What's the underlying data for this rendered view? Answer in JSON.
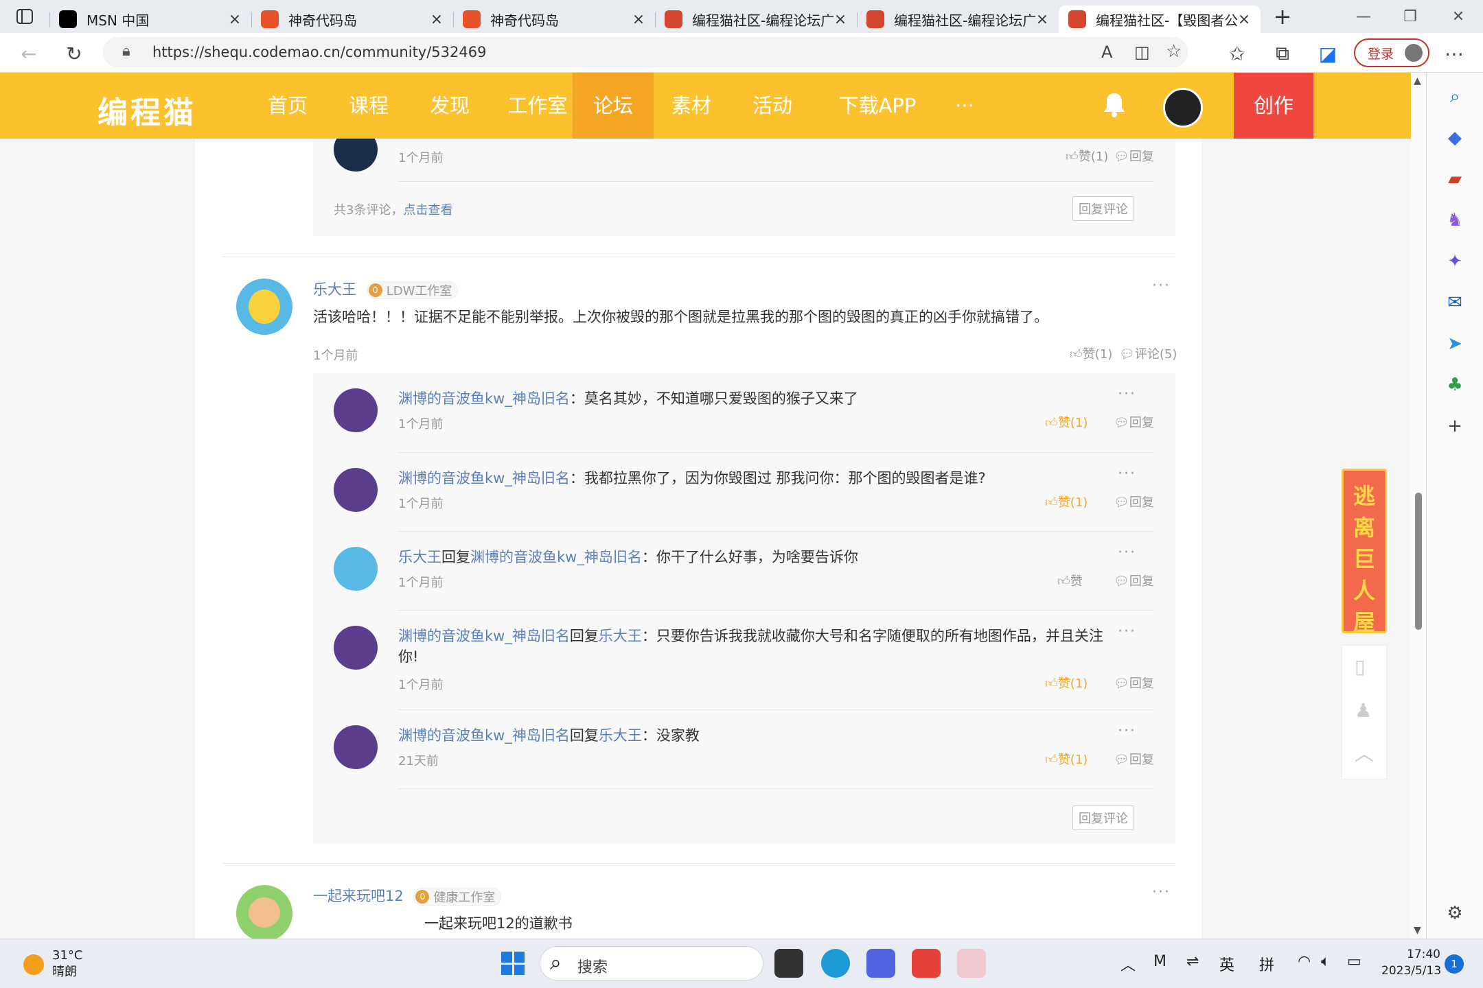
{
  "browser": {
    "tabs": [
      {
        "title": "MSN 中国",
        "favicon": "#000000",
        "active": false
      },
      {
        "title": "神奇代码岛",
        "favicon": "#e8522b",
        "active": false
      },
      {
        "title": "神奇代码岛",
        "favicon": "#e8522b",
        "active": false
      },
      {
        "title": "编程猫社区-编程论坛广场",
        "favicon": "#d6452e",
        "active": false
      },
      {
        "title": "编程猫社区-编程论坛广场",
        "favicon": "#d6452e",
        "active": false
      },
      {
        "title": "编程猫社区-【毁图者公开】",
        "favicon": "#d6452e",
        "active": true
      }
    ],
    "url": "https://shequ.codemao.cn/community/532469",
    "login_label": "登录"
  },
  "site": {
    "logo": "编程猫",
    "nav": [
      "首页",
      "课程",
      "发现",
      "工作室",
      "论坛",
      "素材",
      "活动",
      "下载APP",
      "···"
    ],
    "active_nav": "论坛",
    "create_label": "创作",
    "promo_text": "逃离巨人屋"
  },
  "thread_top": {
    "time": "1个月前",
    "like": "赞(1)",
    "reply": "回复",
    "summary_prefix": "共3条评论，",
    "summary_link": "点击查看",
    "reply_comment": "回复评论"
  },
  "comment": {
    "author": "乐大王",
    "studio": "LDW工作室",
    "studio_level": "0",
    "text": "活该哈哈！！！证据不足能不能别举报。上次你被毁的那个图就是拉黑我的那个图的毁图的真正的凶手你就搞错了。",
    "time": "1个月前",
    "like": "赞(1)",
    "comments": "评论(5)",
    "more": "···",
    "reply_comment": "回复评论",
    "replies": [
      {
        "author": "渊博的音波鱼kw_神岛旧名",
        "target": "",
        "sep": "：",
        "text": "莫名其妙，不知道哪只爱毁图的猴子又来了",
        "time": "1个月前",
        "like": "赞(1)",
        "liked": true,
        "reply": "回复",
        "more": "···"
      },
      {
        "author": "渊博的音波鱼kw_神岛旧名",
        "target": "",
        "sep": "：",
        "text": "我都拉黑你了，因为你毁图过 那我问你：那个图的毁图者是谁?",
        "time": "1个月前",
        "like": "赞(1)",
        "liked": true,
        "reply": "回复",
        "more": "···"
      },
      {
        "author": "乐大王",
        "reply_word": "回复",
        "target": "渊博的音波鱼kw_神岛旧名",
        "sep": "：",
        "text": "你干了什么好事，为啥要告诉你",
        "time": "1个月前",
        "like": "赞",
        "liked": false,
        "reply": "回复",
        "more": "···"
      },
      {
        "author": "渊博的音波鱼kw_神岛旧名",
        "reply_word": "回复",
        "target": "乐大王",
        "sep": "：",
        "text": "只要你告诉我我就收藏你大号和名字随便取的所有地图作品，并且关注你!",
        "time": "1个月前",
        "like": "赞(1)",
        "liked": true,
        "reply": "回复",
        "more": "···"
      },
      {
        "author": "渊博的音波鱼kw_神岛旧名",
        "reply_word": "回复",
        "target": "乐大王",
        "sep": "：",
        "text": "没家教",
        "time": "21天前",
        "like": "赞(1)",
        "liked": true,
        "reply": "回复",
        "more": "···"
      }
    ]
  },
  "next_comment": {
    "author": "一起来玩吧12",
    "studio": "健康工作室",
    "studio_level": "0",
    "text": "一起来玩吧12的道歉书",
    "more": "···"
  },
  "taskbar": {
    "temperature": "31°C",
    "weather": "晴朗",
    "search_label": "搜索",
    "ime_lang": "英",
    "ime_mode": "拼",
    "time": "17:40",
    "date": "2023/5/13",
    "notifications": "1"
  }
}
